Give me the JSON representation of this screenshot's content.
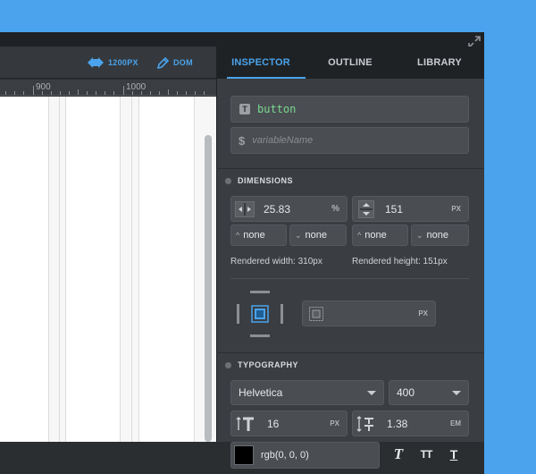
{
  "header": {
    "width_label": "1200PX",
    "dom_label": "DOM"
  },
  "ruler": {
    "labels": [
      "900",
      "1000"
    ]
  },
  "tabs": [
    {
      "label": "INSPECTOR",
      "active": true
    },
    {
      "label": "OUTLINE",
      "active": false
    },
    {
      "label": "LIBRARY",
      "active": false
    }
  ],
  "element": {
    "name": "button",
    "variable_placeholder": "variableName"
  },
  "dimensions": {
    "title": "DIMENSIONS",
    "width_value": "25.83",
    "width_unit": "%",
    "height_value": "151",
    "height_unit": "PX",
    "min_width": "none",
    "max_width": "none",
    "min_height": "none",
    "max_height": "none",
    "rendered_width": "Rendered width: 310px",
    "rendered_height": "Rendered height: 151px",
    "padding_unit": "PX"
  },
  "typography": {
    "title": "TYPOGRAPHY",
    "font_family": "Helvetica",
    "font_weight": "400",
    "font_size": "16",
    "font_size_unit": "PX",
    "line_height": "1.38",
    "line_height_unit": "EM",
    "color": "rgb(0, 0, 0)"
  },
  "colors": {
    "accent": "#4aa3ec",
    "panel": "#3a3e42",
    "string_green": "#7bd88f"
  }
}
